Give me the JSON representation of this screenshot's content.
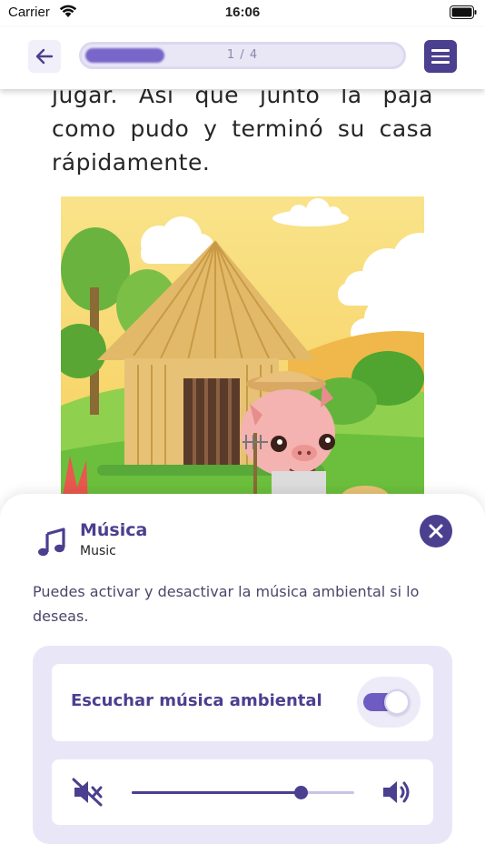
{
  "status_bar": {
    "carrier": "Carrier",
    "time": "16:06"
  },
  "nav": {
    "back_icon": "arrow-left-icon",
    "progress_text": "1 / 4",
    "progress_value": 0.25,
    "menu_icon": "hamburger-menu-icon"
  },
  "story": {
    "lines": [
      "jugar. Así que juntó la paja",
      "como pudo y terminó su casa",
      "rápidamente."
    ]
  },
  "music_sheet": {
    "icon": "music-note-icon",
    "title": "Música",
    "subtitle": "Music",
    "close_icon": "close-icon",
    "description": "Puedes activar y desactivar la música ambiental si lo deseas.",
    "toggle_label": "Escuchar música ambiental",
    "toggle_on": true,
    "volume": 0.76,
    "mute_icon": "volume-mute-icon",
    "volume_icon": "volume-up-icon"
  },
  "colors": {
    "accent": "#4b3f8f",
    "accent_light": "#e9e7f7",
    "toggle": "#6e5cc2"
  }
}
